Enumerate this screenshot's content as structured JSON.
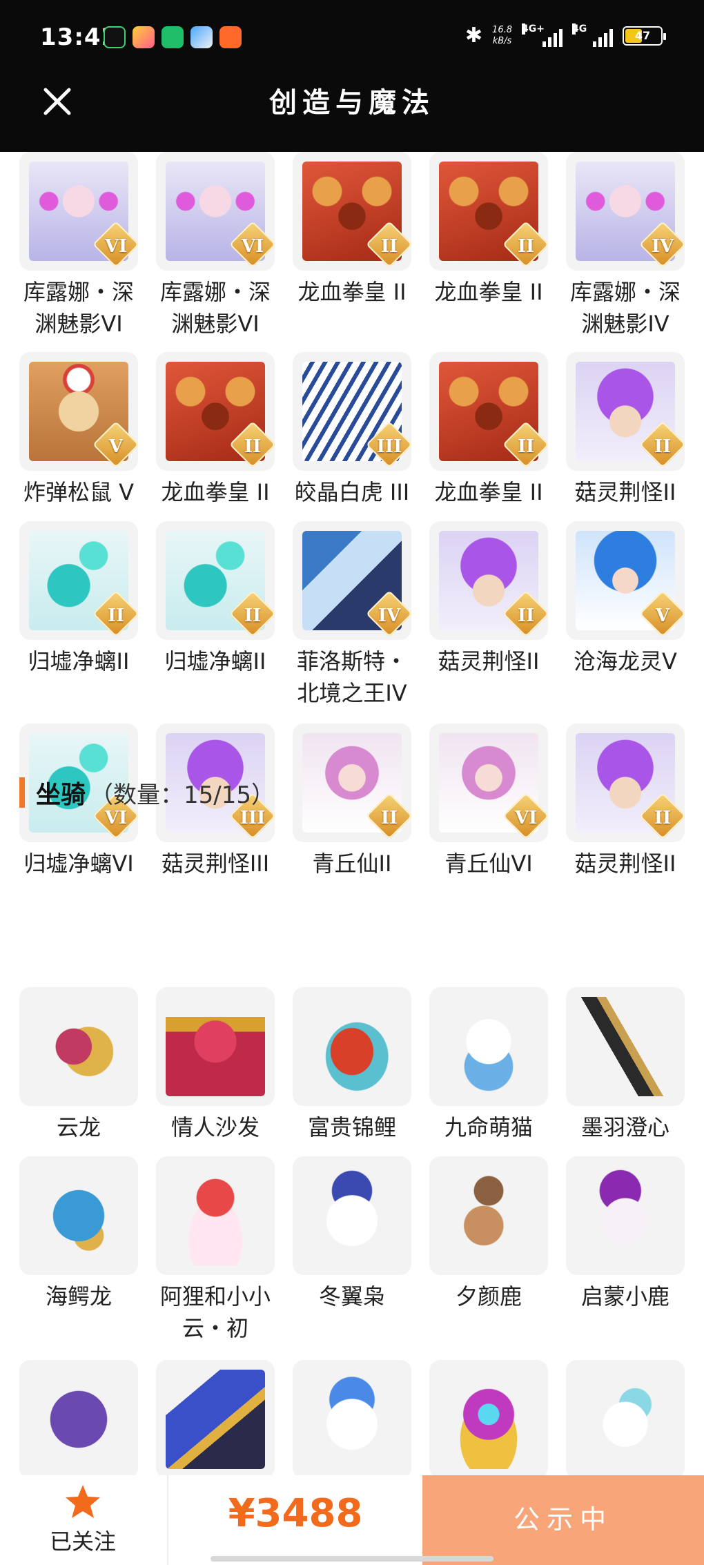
{
  "status_bar": {
    "time": "13:42",
    "net_speed_value": "16.8",
    "net_speed_unit": "kB/s",
    "signal_1": "4G+",
    "signal_2": "4G",
    "battery": "47",
    "battery_color": "#f5c518"
  },
  "header": {
    "title": "创造与魔法",
    "close_icon": "close-icon"
  },
  "pets": [
    {
      "label": "库露娜・深渊魅影VI",
      "badge": "VI",
      "art": "girl-white"
    },
    {
      "label": "库露娜・深渊魅影VI",
      "badge": "VI",
      "art": "girl-white"
    },
    {
      "label": "龙血拳皇 II",
      "badge": "II",
      "art": "red-beast"
    },
    {
      "label": "龙血拳皇 II",
      "badge": "II",
      "art": "red-beast"
    },
    {
      "label": "库露娜・深渊魅影IV",
      "badge": "IV",
      "art": "girl-white"
    },
    {
      "label": "炸弹松鼠 V",
      "badge": "V",
      "art": "squirrel"
    },
    {
      "label": "龙血拳皇 II",
      "badge": "II",
      "art": "red-beast"
    },
    {
      "label": "皎晶白虎 III",
      "badge": "III",
      "art": "tiger"
    },
    {
      "label": "龙血拳皇 II",
      "badge": "II",
      "art": "red-beast"
    },
    {
      "label": "菇灵荆怪II",
      "badge": "II",
      "art": "purple-kid"
    },
    {
      "label": "归墟净螭II",
      "badge": "II",
      "art": "cyan-dragon"
    },
    {
      "label": "归墟净螭II",
      "badge": "II",
      "art": "cyan-dragon"
    },
    {
      "label": "菲洛斯特・北境之王IV",
      "badge": "IV",
      "art": "ice-king"
    },
    {
      "label": "菇灵荆怪II",
      "badge": "II",
      "art": "purple-kid"
    },
    {
      "label": "沧海龙灵V",
      "badge": "V",
      "art": "sea-spirit"
    },
    {
      "label": "归墟净螭VI",
      "badge": "VI",
      "art": "cyan-dragon"
    },
    {
      "label": "菇灵荆怪III",
      "badge": "III",
      "art": "purple-kid"
    },
    {
      "label": "青丘仙II",
      "badge": "II",
      "art": "fox-girl"
    },
    {
      "label": "青丘仙VI",
      "badge": "VI",
      "art": "fox-girl"
    },
    {
      "label": "菇灵荆怪II",
      "badge": "II",
      "art": "purple-kid"
    }
  ],
  "mounts_section": {
    "title": "坐骑",
    "count": "（数量：15/15）"
  },
  "mounts": [
    {
      "label": "云龙",
      "art": "cloud-dragon"
    },
    {
      "label": "情人沙发",
      "art": "sofa"
    },
    {
      "label": "富贵锦鲤",
      "art": "koi"
    },
    {
      "label": "九命萌猫",
      "art": "cat"
    },
    {
      "label": "墨羽澄心",
      "art": "feather"
    },
    {
      "label": "海鳄龙",
      "art": "sea-croc"
    },
    {
      "label": "阿狸和小小云・初",
      "art": "ali"
    },
    {
      "label": "冬翼枭",
      "art": "owl"
    },
    {
      "label": "夕颜鹿",
      "art": "deer"
    },
    {
      "label": "启蒙小鹿",
      "art": "fawn"
    },
    {
      "label": "",
      "art": "dino"
    },
    {
      "label": "",
      "art": "mecha-bird"
    },
    {
      "label": "",
      "art": "unicorn"
    },
    {
      "label": "",
      "art": "heart-wing"
    },
    {
      "label": "",
      "art": "white-bird"
    }
  ],
  "bottom_bar": {
    "follow_label": "已关注",
    "price": "¥3488",
    "status_label": "公示中",
    "accent": "#f26a1b",
    "button_color": "#f8a57a"
  }
}
